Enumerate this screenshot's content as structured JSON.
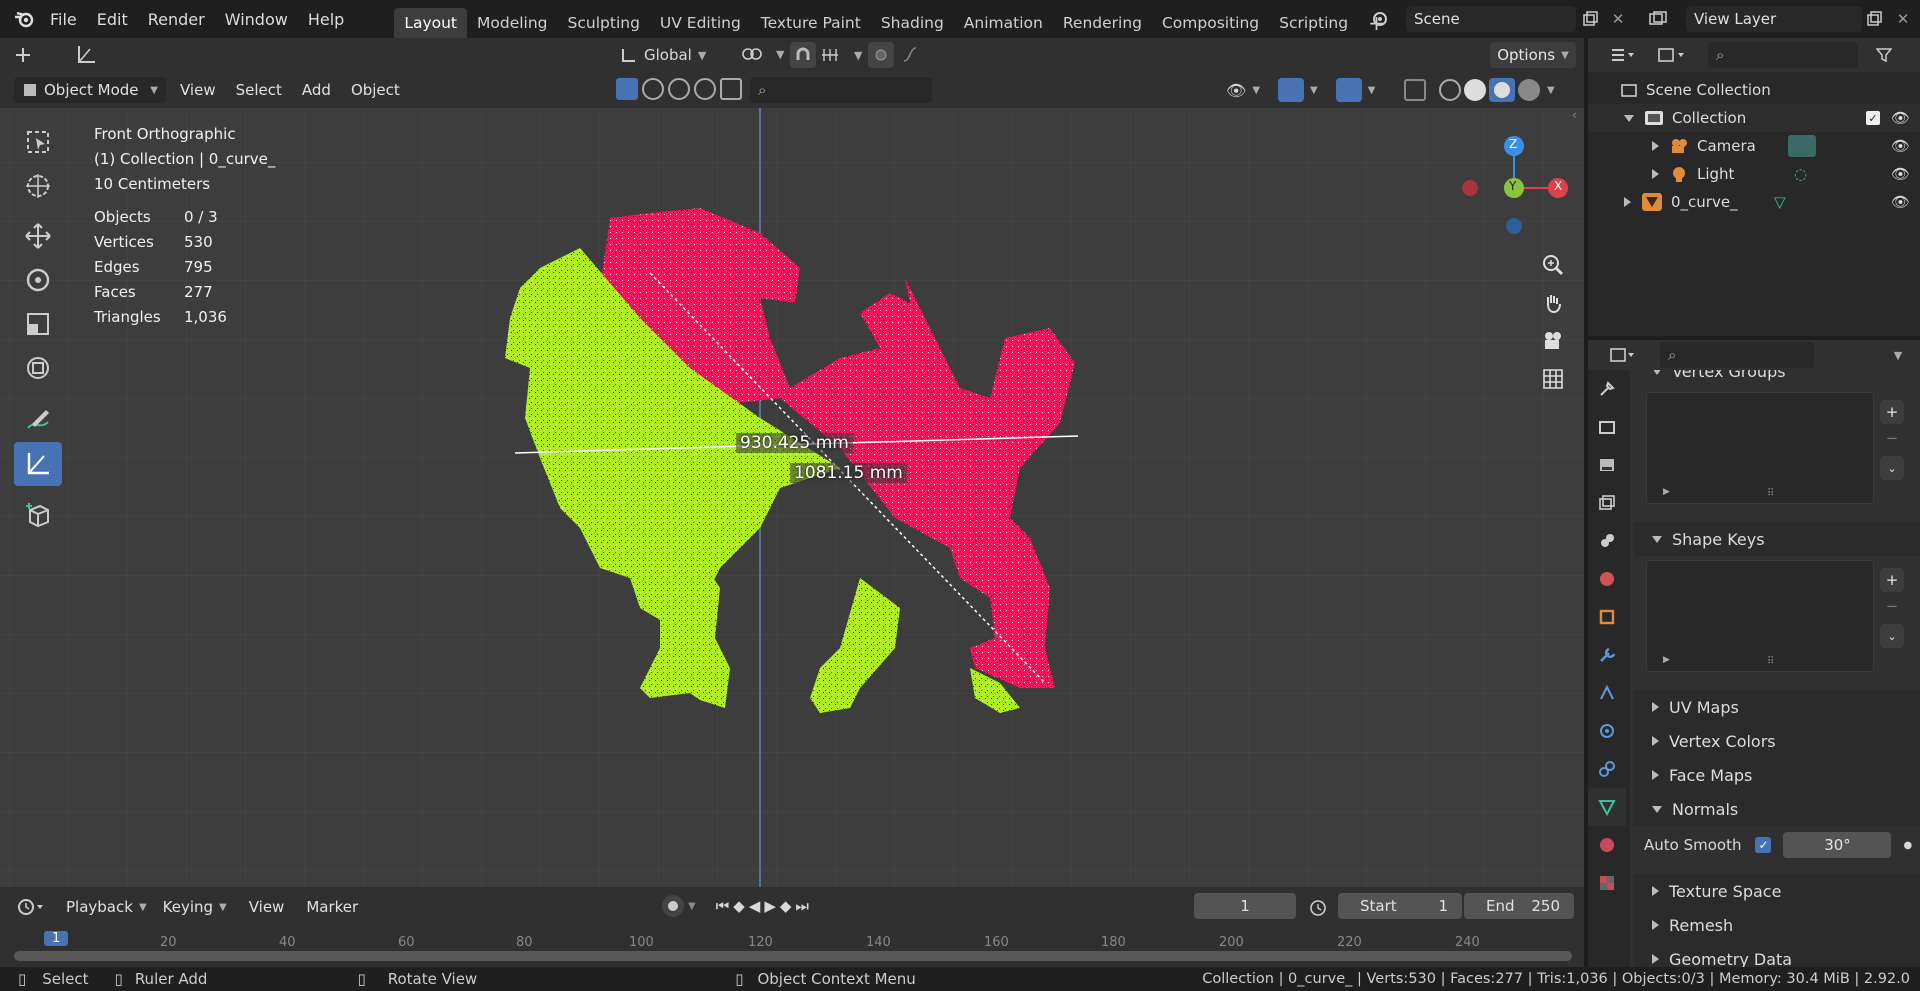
{
  "top_menu": [
    "File",
    "Edit",
    "Render",
    "Window",
    "Help"
  ],
  "workspaces": [
    "Layout",
    "Modeling",
    "Sculpting",
    "UV Editing",
    "Texture Paint",
    "Shading",
    "Animation",
    "Rendering",
    "Compositing",
    "Scripting"
  ],
  "active_workspace": "Layout",
  "scene": {
    "value": "Scene"
  },
  "view_layer": {
    "value": "View Layer"
  },
  "tool_header": {
    "transform_orientation": "Global",
    "options_label": "Options"
  },
  "viewport_header": {
    "mode": "Object Mode",
    "menus": [
      "View",
      "Select",
      "Add",
      "Object"
    ]
  },
  "overlay_info": {
    "view": "Front Orthographic",
    "collection": "(1) Collection | 0_curve_",
    "scale": "10 Centimeters",
    "stats": [
      {
        "label": "Objects",
        "value": "0 / 3"
      },
      {
        "label": "Vertices",
        "value": "530"
      },
      {
        "label": "Edges",
        "value": "795"
      },
      {
        "label": "Faces",
        "value": "277"
      },
      {
        "label": "Triangles",
        "value": "1,036"
      }
    ]
  },
  "gizmo": {
    "z": "Z",
    "y": "Y",
    "x": "X"
  },
  "measurements": {
    "horizontal": "930.425 mm",
    "diagonal": "1081.15 mm"
  },
  "outliner": {
    "root": "Scene Collection",
    "items": [
      {
        "name": "Collection"
      },
      {
        "name": "Camera"
      },
      {
        "name": "Light"
      },
      {
        "name": "0_curve_"
      }
    ]
  },
  "properties": {
    "panels": {
      "vertex_groups": "Vertex Groups",
      "shape_keys": "Shape Keys",
      "uv_maps": "UV Maps",
      "vertex_colors": "Vertex Colors",
      "face_maps": "Face Maps",
      "normals": "Normals",
      "texture_space": "Texture Space",
      "remesh": "Remesh",
      "geometry_data": "Geometry Data"
    },
    "auto_smooth_label": "Auto Smooth",
    "auto_smooth_angle": "30°"
  },
  "timeline": {
    "menus": [
      "Playback",
      "Keying",
      "View",
      "Marker"
    ],
    "current_frame": "1",
    "start_label": "Start",
    "start": "1",
    "end_label": "End",
    "end": "250",
    "ruler_ticks": [
      "1",
      "20",
      "40",
      "60",
      "80",
      "100",
      "120",
      "140",
      "160",
      "180",
      "200",
      "220",
      "240"
    ]
  },
  "status_bar": {
    "select": "Select",
    "ruler_add": "Ruler Add",
    "rotate_view": "Rotate View",
    "context_menu": "Object Context Menu",
    "info": "Collection | 0_curve_ | Verts:530 | Faces:277 | Tris:1,036 | Objects:0/3 | Memory: 30.4 MiB | 2.92.0"
  },
  "colors": {
    "accent": "#4772b3",
    "lion_red": "#f0145a",
    "lion_green": "#a8f020",
    "axis_x": "#e0404a",
    "axis_y": "#8bc43a",
    "axis_z": "#3b8fe0"
  }
}
